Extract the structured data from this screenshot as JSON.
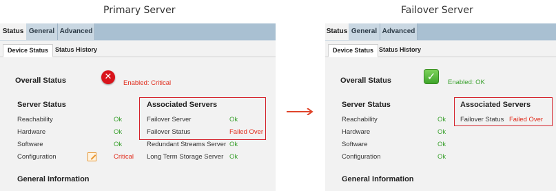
{
  "primary": {
    "heading": "Primary Server",
    "tabs": [
      "Status",
      "General",
      "Advanced"
    ],
    "subtabs": [
      "Device Status",
      "Status History"
    ],
    "overall_status": {
      "label": "Overall Status",
      "icon": "error-icon",
      "value": "Enabled: Critical"
    },
    "server_status": {
      "title": "Server Status",
      "rows": [
        {
          "label": "Reachability",
          "value": "Ok"
        },
        {
          "label": "Hardware",
          "value": "Ok"
        },
        {
          "label": "Software",
          "value": "Ok"
        },
        {
          "label": "Configuration",
          "value": "Critical",
          "icon": "edit-icon"
        }
      ]
    },
    "associated_servers": {
      "title": "Associated Servers",
      "rows": [
        {
          "label": "Failover Server",
          "value": "Ok"
        },
        {
          "label": "Failover Status",
          "value": "Failed Over"
        },
        {
          "label": "Redundant Streams Server",
          "value": "Ok"
        },
        {
          "label": "Long Term Storage Server",
          "value": "Ok"
        }
      ]
    },
    "general_information": "General Information"
  },
  "failover": {
    "heading": "Failover Server",
    "tabs": [
      "Status",
      "General",
      "Advanced"
    ],
    "subtabs": [
      "Device Status",
      "Status History"
    ],
    "overall_status": {
      "label": "Overall Status",
      "icon": "check-icon",
      "value": "Enabled: OK"
    },
    "server_status": {
      "title": "Server Status",
      "rows": [
        {
          "label": "Reachability",
          "value": "Ok"
        },
        {
          "label": "Hardware",
          "value": "Ok"
        },
        {
          "label": "Software",
          "value": "Ok"
        },
        {
          "label": "Configuration",
          "value": "Ok"
        }
      ]
    },
    "associated_servers": {
      "title": "Associated Servers",
      "rows": [
        {
          "label": "Failover Status",
          "value": "Failed Over"
        }
      ]
    },
    "general_information": "General Information"
  },
  "colors": {
    "ok": "#3aa02e",
    "critical": "#e02a1a",
    "tabbar": "#a9c0d2",
    "highlight_box": "#d4212a",
    "arrow": "#e0442a"
  },
  "arrow_icon": "arrow-right-icon"
}
